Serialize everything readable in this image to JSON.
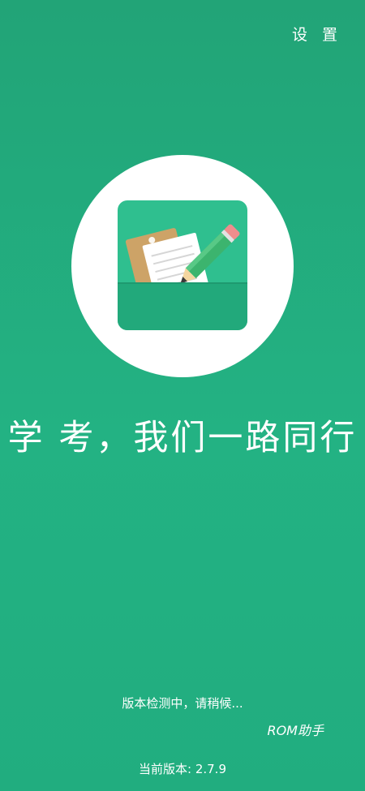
{
  "header": {
    "settings_label": "设 置"
  },
  "logo": {
    "icon": "notebook-pencil-icon"
  },
  "slogan": "学 考，我们一路同行",
  "status_text": "版本检测中，请稍候...",
  "brand": "ROM助手",
  "version_text": "当前版本: 2.7.9",
  "colors": {
    "background": "#23ad7f",
    "icon_bg": "#2fbf8f",
    "pocket": "#22a97b",
    "paper_brown": "#cda367",
    "pencil_green": "#3cb46e",
    "eraser": "#ef8d8d"
  }
}
